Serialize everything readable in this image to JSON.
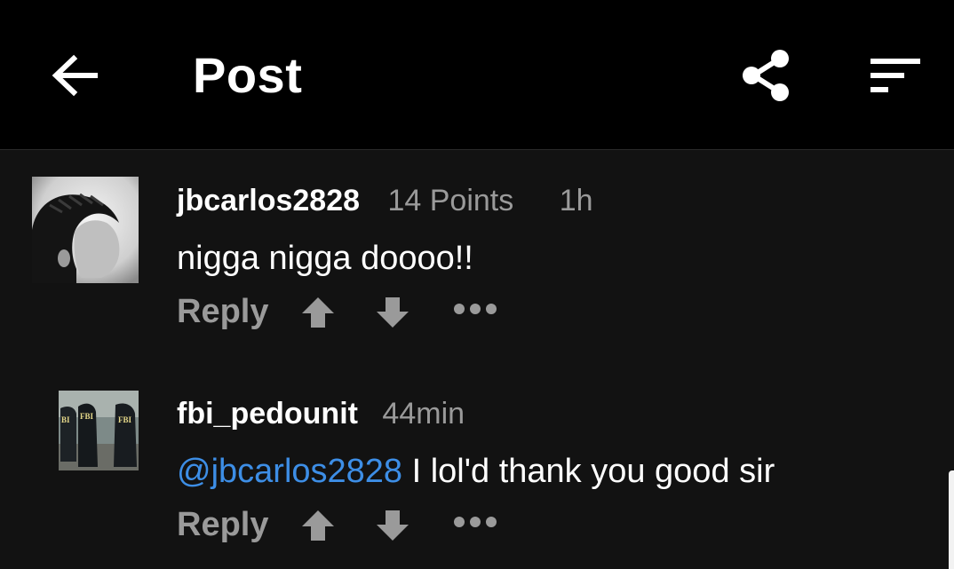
{
  "header": {
    "title": "Post",
    "back_icon": "arrow-left-icon",
    "share_icon": "share-icon",
    "sort_icon": "sort-icon"
  },
  "comments": [
    {
      "username": "jbcarlos2828",
      "points": "14 Points",
      "time": "1h",
      "text": "nigga nigga doooo!!",
      "reply_label": "Reply",
      "avatar_icon": "avatar-photo"
    },
    {
      "username": "fbi_pedounit",
      "time": "44min",
      "mention": "@jbcarlos2828",
      "text": " I lol'd thank you good sir",
      "reply_label": "Reply",
      "avatar_icon": "avatar-photo"
    }
  ],
  "colors": {
    "background": "#121212",
    "topbar": "#000000",
    "secondary_text": "#9a9a9a",
    "mention": "#3d8ee6"
  }
}
